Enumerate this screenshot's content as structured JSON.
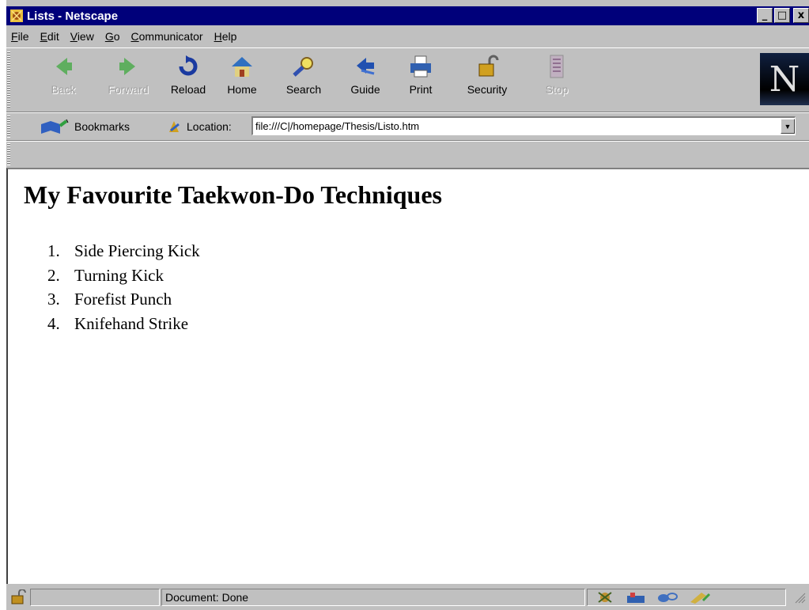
{
  "window": {
    "title": "Lists - Netscape",
    "controls": [
      "_",
      "□",
      "x"
    ]
  },
  "menu": [
    {
      "label": "File",
      "mnemonic": "F",
      "rest": "ile"
    },
    {
      "label": "Edit",
      "mnemonic": "E",
      "rest": "dit"
    },
    {
      "label": "View",
      "mnemonic": "V",
      "rest": "iew"
    },
    {
      "label": "Go",
      "mnemonic": "G",
      "rest": "o"
    },
    {
      "label": "Communicator",
      "mnemonic": "C",
      "rest": "ommunicator"
    },
    {
      "label": "Help",
      "mnemonic": "H",
      "rest": "elp"
    }
  ],
  "toolbar": {
    "back": "Back",
    "forward": "Forward",
    "reload": "Reload",
    "home": "Home",
    "search": "Search",
    "guide": "Guide",
    "print": "Print",
    "security": "Security",
    "stop": "Stop",
    "logo": "N"
  },
  "locationbar": {
    "bookmarks": "Bookmarks",
    "location_label": "Location:",
    "url": "file:///C|/homepage/Thesis/Listo.htm"
  },
  "page": {
    "heading": "My Favourite Taekwon-Do Techniques",
    "items": [
      {
        "num": "1.",
        "text": "Side Piercing Kick"
      },
      {
        "num": "2.",
        "text": "Turning Kick"
      },
      {
        "num": "3.",
        "text": "Forefist Punch"
      },
      {
        "num": "4.",
        "text": "Knifehand Strike"
      }
    ]
  },
  "status": {
    "text": "Document: Done"
  },
  "colors": {
    "titlebar": "#00007a",
    "chrome": "#c0c0c0",
    "content": "#ffffff"
  }
}
